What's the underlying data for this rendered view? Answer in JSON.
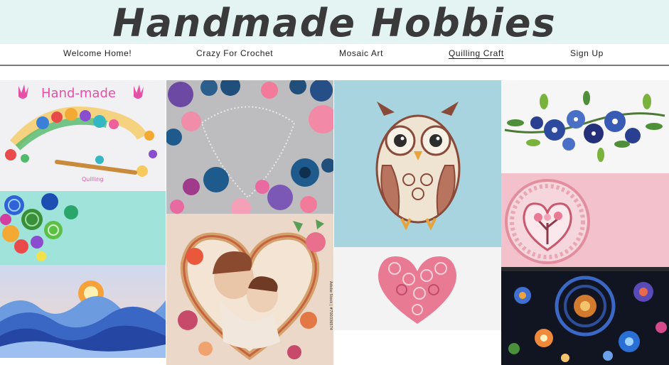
{
  "site": {
    "title": "Handmade Hobbies"
  },
  "nav": {
    "items": [
      {
        "label": "Welcome Home!",
        "active": false
      },
      {
        "label": "Crazy For Crochet",
        "active": false
      },
      {
        "label": "Mosaic Art",
        "active": false
      },
      {
        "label": "Quilling Craft",
        "active": true
      },
      {
        "label": "Sign Up",
        "active": false
      }
    ]
  },
  "gallery": {
    "handmade_text": "Hand-made",
    "quilling_text": "Quilling",
    "watermark": "Adobe Stock | #700336574"
  },
  "colors": {
    "banner": "#e3f4f3",
    "title_text": "#3a3a3a",
    "rule": "#7a7a7a"
  }
}
